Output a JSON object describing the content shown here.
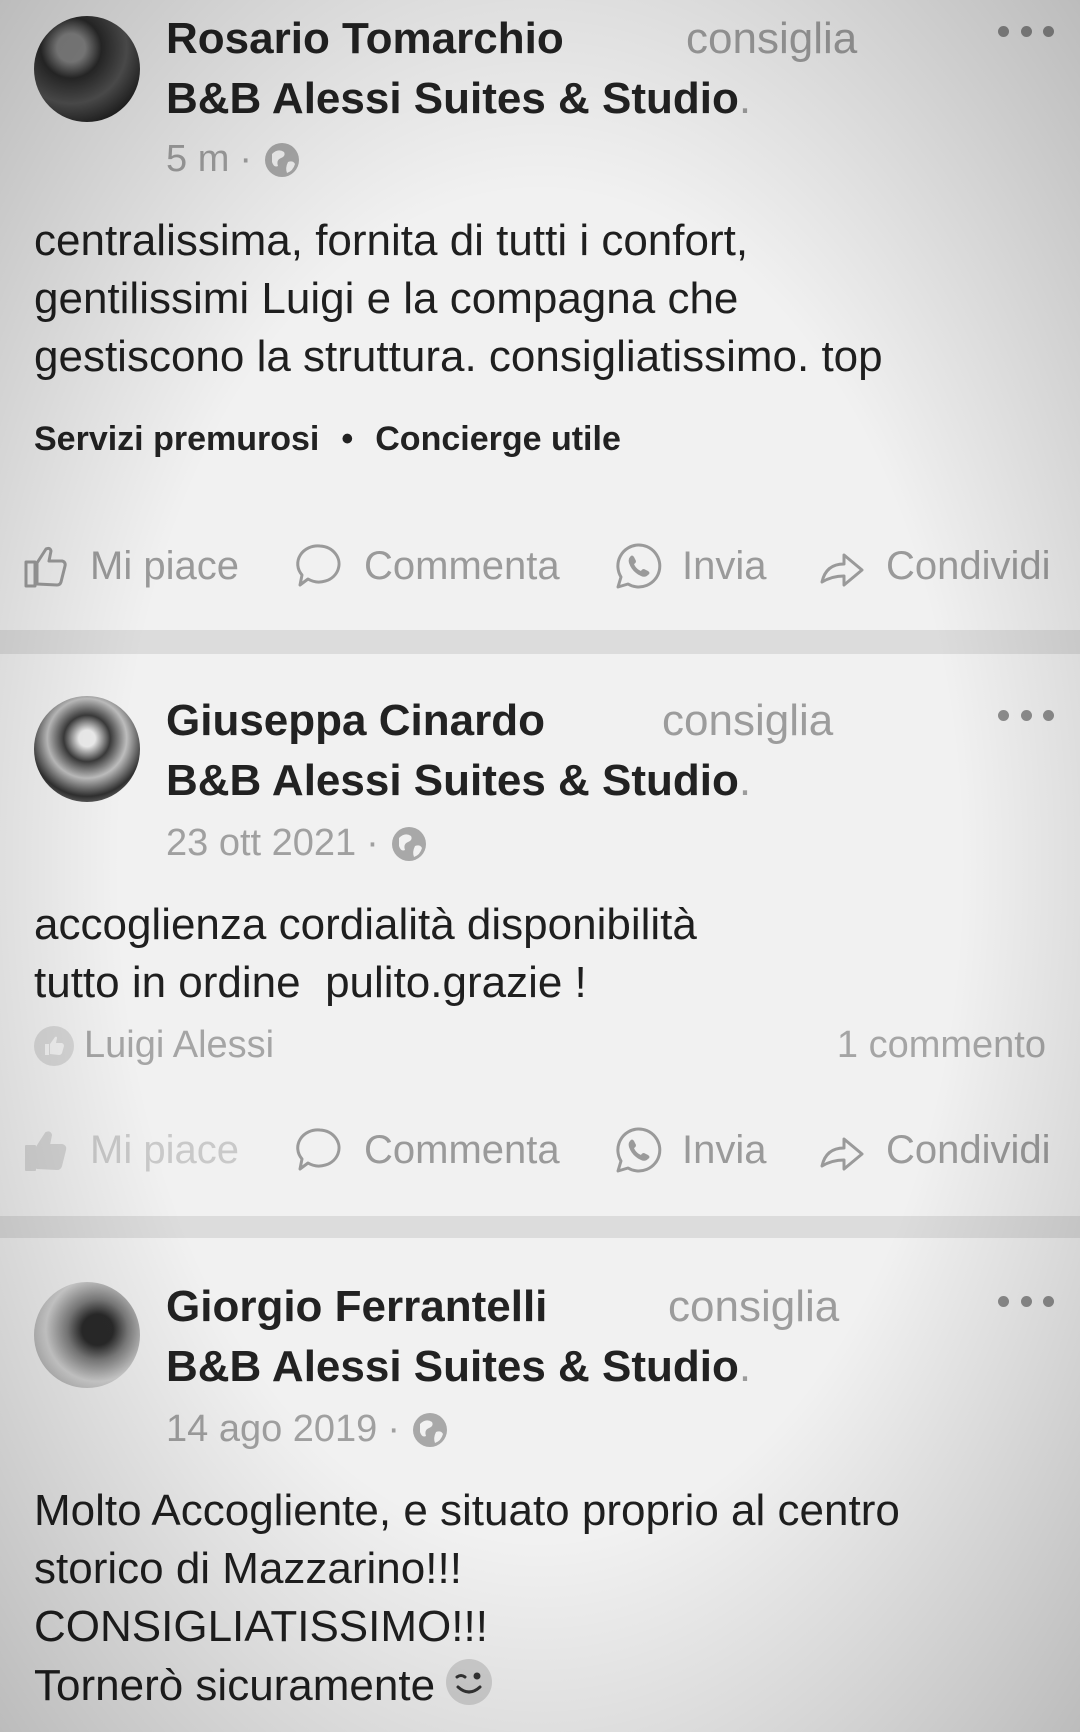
{
  "posts": [
    {
      "author": "Rosario Tomarchio",
      "verb": "consiglia",
      "page": "B&B Alessi Suites & Studio",
      "page_suffix": ".",
      "time": "5 m",
      "separator": "·",
      "body_lines": [
        "centralissima, fornita di tutti i confort,",
        "gentilissimi Luigi e la compagna che",
        "gestiscono la struttura. consigliatissimo. top"
      ],
      "tags": [
        "Servizi premurosi",
        "Concierge utile"
      ],
      "tag_separator": "•"
    },
    {
      "author": "Giuseppa Cinardo",
      "verb": "consiglia",
      "page": "B&B Alessi Suites & Studio",
      "page_suffix": ".",
      "time": "23 ott 2021",
      "separator": "·",
      "body_lines": [
        "accoglienza cordialità disponibilità",
        "tutto in ordine  pulito.grazie !"
      ],
      "liked_by": "Luigi Alessi",
      "comments_count": "1 commento"
    },
    {
      "author": "Giorgio Ferrantelli",
      "verb": "consiglia",
      "page": "B&B Alessi Suites & Studio",
      "page_suffix": ".",
      "time": "14 ago 2019",
      "separator": "·",
      "body_lines": [
        "Molto Accogliente, e situato proprio al centro",
        "storico di Mazzarino!!!",
        "CONSIGLIATISSIMO!!!",
        "Tornerò sicuramente"
      ],
      "emoji": "wink-face-icon"
    }
  ],
  "actions": {
    "like": "Mi piace",
    "comment": "Commenta",
    "send": "Invia",
    "share": "Condividi"
  },
  "icons": {
    "like": "thumbs-up-icon",
    "comment": "comment-bubble-icon",
    "send": "whatsapp-icon",
    "share": "share-arrow-icon",
    "visibility": "globe-icon",
    "more": "more-options-icon"
  },
  "colors": {
    "background": "#e6e6e6",
    "card": "#f1f1f1",
    "text": "#1f1f1f",
    "muted": "#9c9c9c"
  }
}
